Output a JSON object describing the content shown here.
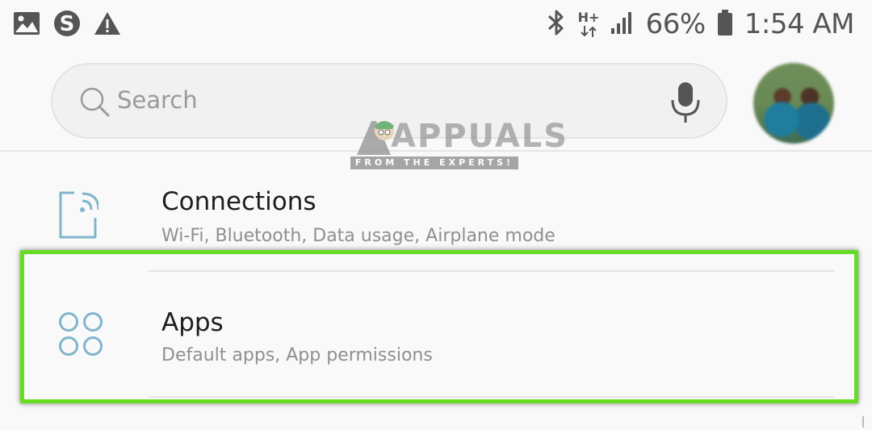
{
  "status_bar": {
    "network_type": "H+",
    "battery_percent": "66%",
    "time": "1:54 AM",
    "left_icons": [
      "image-notification-icon",
      "skype-icon",
      "warning-icon"
    ],
    "right_icons": [
      "bluetooth-icon",
      "signal-icon",
      "battery-icon"
    ]
  },
  "search": {
    "placeholder": "Search"
  },
  "watermark": {
    "title": "APPUALS",
    "tagline": "FROM THE EXPERTS!"
  },
  "settings_list": [
    {
      "title": "Connections",
      "subtitle": "Wi-Fi, Bluetooth, Data usage, Airplane mode",
      "icon": "connections-icon"
    },
    {
      "title": "Apps",
      "subtitle": "Default apps, App permissions",
      "icon": "apps-grid-icon",
      "highlighted": true
    }
  ],
  "colors": {
    "highlight": "#66dd22",
    "icon_accent": "#7fb6cc",
    "background": "#f9f9f9"
  }
}
